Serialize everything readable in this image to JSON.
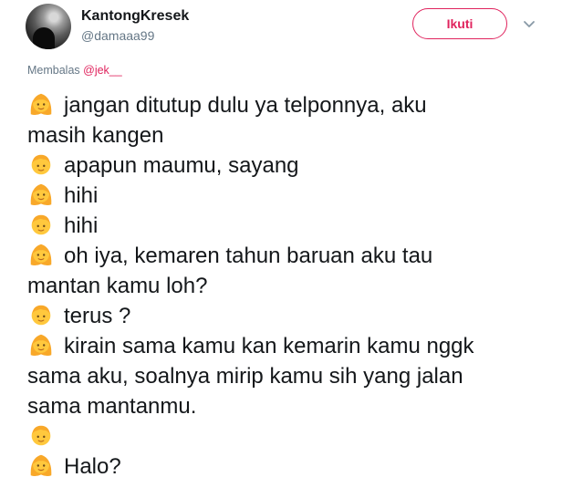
{
  "user": {
    "name": "KantongKresek",
    "handle": "@damaaa99",
    "follow_label": "Ikuti"
  },
  "reply": {
    "prefix": "Membalas ",
    "mention": "@jek__"
  },
  "tweet": {
    "lines": [
      {
        "emoji": "girl-emoji",
        "text": "jangan ditutup dulu ya telponnya, aku"
      },
      {
        "emoji": null,
        "text": "masih kangen"
      },
      {
        "emoji": "boy-emoji",
        "text": "apapun maumu, sayang"
      },
      {
        "emoji": "girl-emoji",
        "text": "hihi"
      },
      {
        "emoji": "boy-emoji",
        "text": "hihi"
      },
      {
        "emoji": "girl-emoji",
        "text": "oh iya, kemaren tahun baruan aku tau"
      },
      {
        "emoji": null,
        "text": "mantan kamu loh?"
      },
      {
        "emoji": "boy-emoji",
        "text": "terus ?"
      },
      {
        "emoji": "girl-emoji",
        "text": "kirain sama kamu kan kemarin kamu nggk"
      },
      {
        "emoji": null,
        "text": "sama aku, soalnya mirip kamu sih yang jalan"
      },
      {
        "emoji": null,
        "text": "sama mantanmu."
      },
      {
        "emoji": "boy-emoji",
        "text": ""
      },
      {
        "emoji": "girl-emoji",
        "text": "Halo?"
      }
    ]
  },
  "colors": {
    "accent": "#e0245e",
    "secondary_text": "#657786",
    "primary_text": "#14171a",
    "emoji_face": "#ffc83d",
    "emoji_hair": "#f8a829"
  }
}
